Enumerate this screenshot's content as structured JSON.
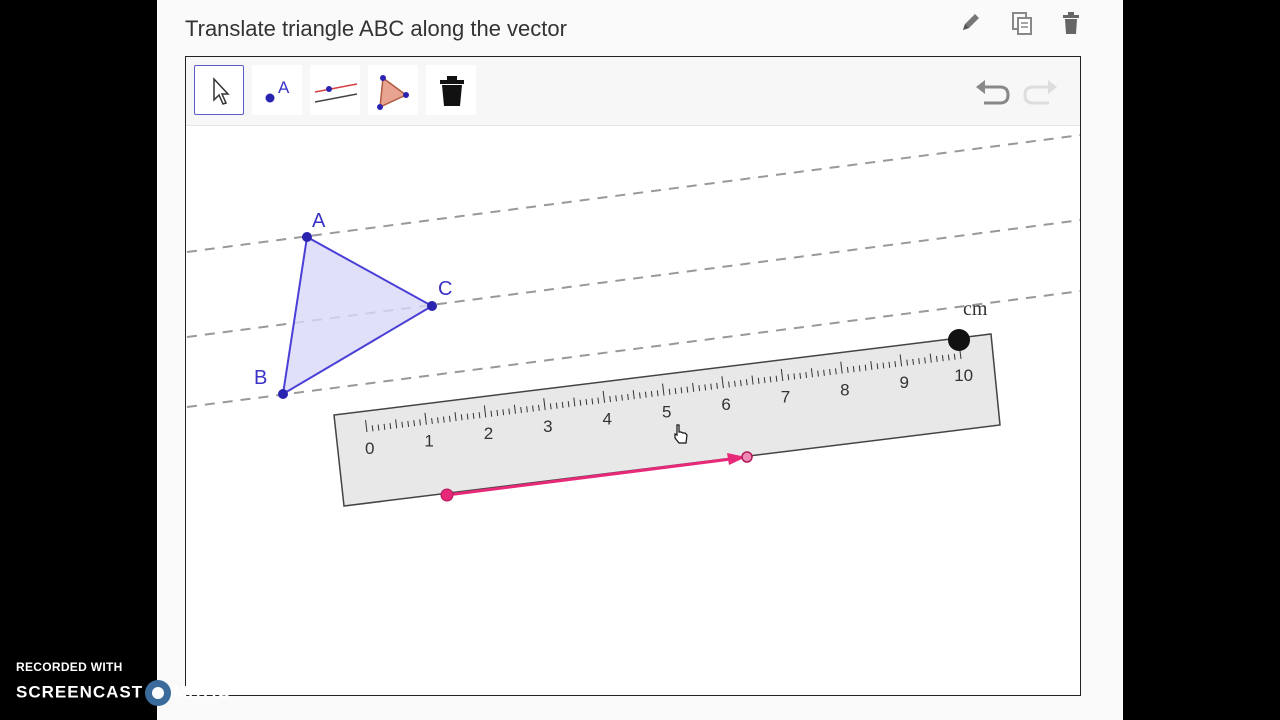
{
  "header": {
    "title": "Translate triangle ABC along the vector",
    "icons": [
      "pencil-icon",
      "duplicate-icon",
      "trash-icon"
    ]
  },
  "toolbar": {
    "tools": [
      {
        "name": "move-tool",
        "icon": "pointer-arrow-icon",
        "active": true
      },
      {
        "name": "point-tool",
        "icon": "point-a-icon",
        "label": "A"
      },
      {
        "name": "parallel-line-tool",
        "icon": "parallel-line-icon"
      },
      {
        "name": "polygon-tool",
        "icon": "polygon-icon"
      },
      {
        "name": "delete-tool",
        "icon": "trash-icon"
      }
    ],
    "undo": "undo-icon",
    "redo": "redo-icon"
  },
  "graphics": {
    "triangle": {
      "A": "A",
      "B": "B",
      "C": "C"
    },
    "ruler": {
      "unit": "cm",
      "labels": [
        "0",
        "1",
        "2",
        "3",
        "4",
        "5",
        "6",
        "7",
        "8",
        "9",
        "10"
      ]
    },
    "colors": {
      "triangle": "#4a3fd6",
      "triangle_fill": "#d8d8f6",
      "vector": "#e8297a",
      "ruler": "#e8e8e8"
    }
  },
  "footer": {
    "recorded": "RECORDED WITH",
    "brand_left": "SCREENCAST",
    "brand_right": "MATIC"
  }
}
